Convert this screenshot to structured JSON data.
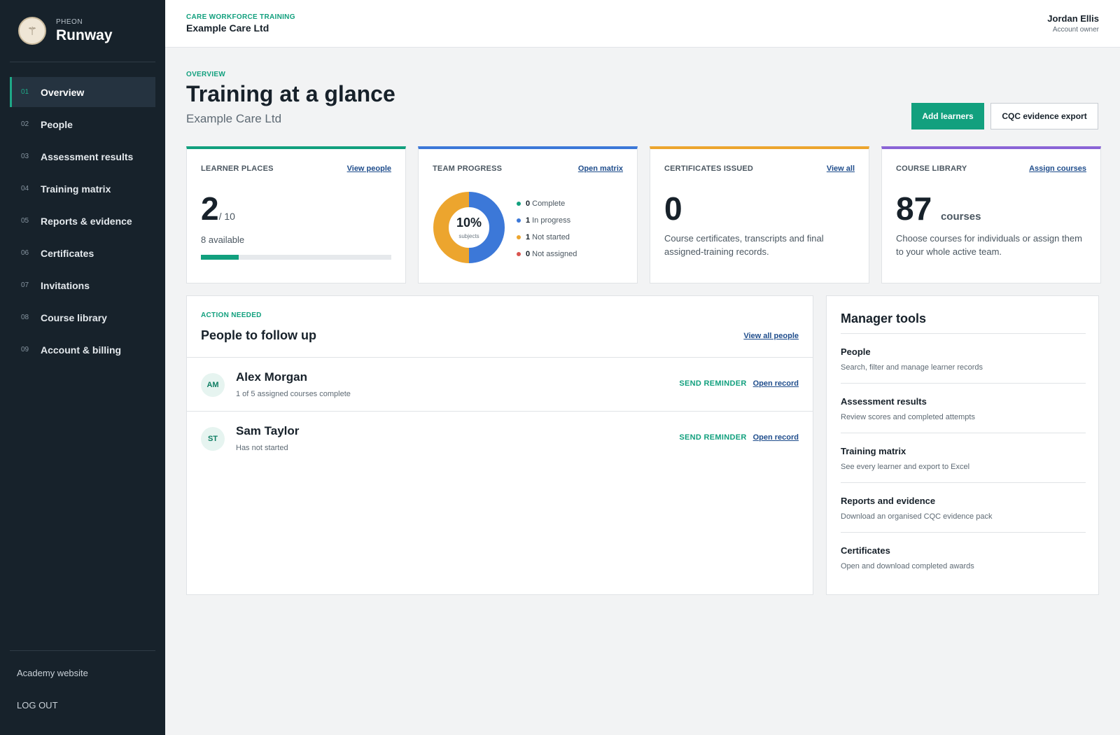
{
  "sidebar": {
    "brand_small": "PHEON",
    "brand_name": "Runway",
    "logo_glyph": "⚚",
    "items": [
      {
        "num": "01",
        "label": "Overview",
        "active": true
      },
      {
        "num": "02",
        "label": "People"
      },
      {
        "num": "03",
        "label": "Assessment results"
      },
      {
        "num": "04",
        "label": "Training matrix"
      },
      {
        "num": "05",
        "label": "Reports & evidence"
      },
      {
        "num": "06",
        "label": "Certificates"
      },
      {
        "num": "07",
        "label": "Invitations"
      },
      {
        "num": "08",
        "label": "Course library"
      },
      {
        "num": "09",
        "label": "Account & billing"
      }
    ],
    "academy_link": "Academy website",
    "logout": "LOG OUT"
  },
  "topbar": {
    "kicker": "CARE WORKFORCE TRAINING",
    "org_name": "Example Care Ltd",
    "user_name": "Jordan Ellis",
    "user_role": "Account owner"
  },
  "header": {
    "kicker": "OVERVIEW",
    "title": "Training at a glance",
    "subtitle": "Example Care Ltd",
    "add_learners": "Add learners",
    "export": "CQC evidence export"
  },
  "cards": {
    "learner_places": {
      "label": "LEARNER PLACES",
      "link": "View people",
      "value": "2",
      "total": "/ 10",
      "available": "8 available",
      "filled_fraction": 0.2,
      "accent": "#12a07e"
    },
    "team_progress": {
      "label": "TEAM PROGRESS",
      "link": "Open matrix",
      "percent": "10%",
      "caption": "subjects",
      "accent": "#3c78d8",
      "legend": [
        {
          "count": "0",
          "label": "Complete",
          "color": "#12a07e",
          "value": 0
        },
        {
          "count": "1",
          "label": "In progress",
          "color": "#3c78d8",
          "value": 1
        },
        {
          "count": "1",
          "label": "Not started",
          "color": "#eca52e",
          "value": 1
        },
        {
          "count": "0",
          "label": "Not assigned",
          "color": "#d9544f",
          "value": 0
        }
      ]
    },
    "certificates": {
      "label": "CERTIFICATES ISSUED",
      "link": "View all",
      "value": "0",
      "description": "Course certificates, transcripts and final assigned-training records.",
      "accent": "#eca52e"
    },
    "course_library": {
      "label": "COURSE LIBRARY",
      "link": "Assign courses",
      "value": "87",
      "suffix": "courses",
      "description": "Choose courses for individuals or assign them to your whole active team.",
      "accent": "#8a64d6"
    }
  },
  "followup": {
    "kicker": "ACTION NEEDED",
    "title": "People to follow up",
    "link": "View all people",
    "reminder_label": "SEND REMINDER",
    "open_label": "Open record",
    "people": [
      {
        "initials": "AM",
        "name": "Alex Morgan",
        "status": "1 of 5 assigned courses complete"
      },
      {
        "initials": "ST",
        "name": "Sam Taylor",
        "status": "Has not started"
      }
    ]
  },
  "manager_tools": {
    "title": "Manager tools",
    "items": [
      {
        "name": "People",
        "desc": "Search, filter and manage learner records"
      },
      {
        "name": "Assessment results",
        "desc": "Review scores and completed attempts"
      },
      {
        "name": "Training matrix",
        "desc": "See every learner and export to Excel"
      },
      {
        "name": "Reports and evidence",
        "desc": "Download an organised CQC evidence pack"
      },
      {
        "name": "Certificates",
        "desc": "Open and download completed awards"
      }
    ]
  }
}
